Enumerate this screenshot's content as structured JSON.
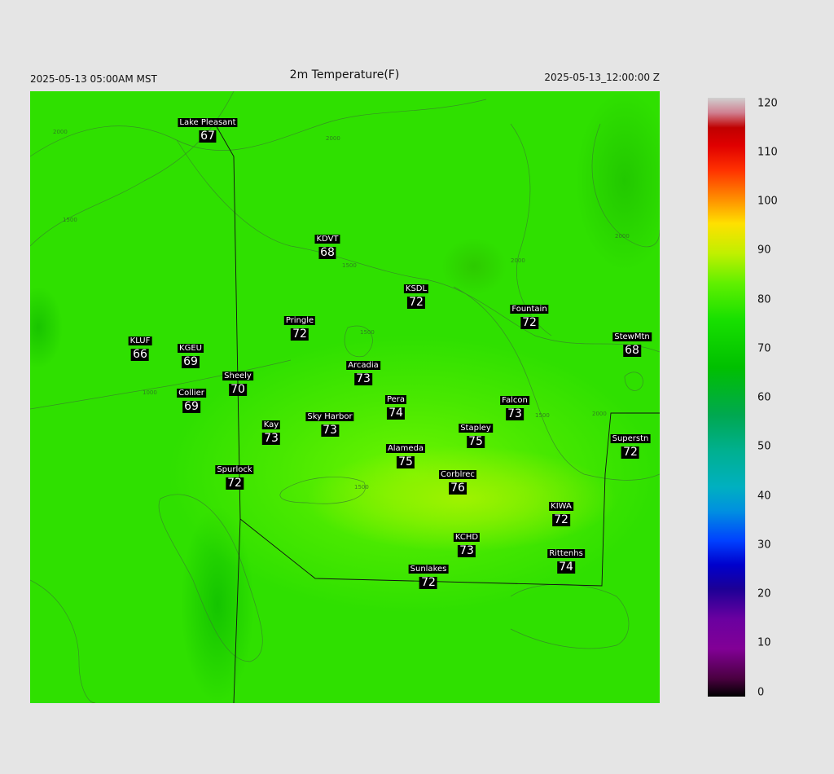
{
  "header": {
    "local_time": "2025-05-13 05:00AM MST",
    "title": "2m Temperature(F)",
    "utc_time": "2025-05-13_12:00:00 Z"
  },
  "contour_labels": [
    "2000",
    "1500",
    "1000",
    "1500",
    "1500",
    "1500",
    "2000",
    "1500",
    "2000",
    "2000",
    "2000"
  ],
  "stations": [
    {
      "name": "Lake Pleasant",
      "value": "67"
    },
    {
      "name": "KDVT",
      "value": "68"
    },
    {
      "name": "KSDL",
      "value": "72"
    },
    {
      "name": "Pringle",
      "value": "72"
    },
    {
      "name": "Fountain",
      "value": "72"
    },
    {
      "name": "KLUF",
      "value": "66"
    },
    {
      "name": "KGEU",
      "value": "69"
    },
    {
      "name": "StewMtn",
      "value": "68"
    },
    {
      "name": "Arcadia",
      "value": "73"
    },
    {
      "name": "Sheely",
      "value": "70"
    },
    {
      "name": "Collier",
      "value": "69"
    },
    {
      "name": "Pera",
      "value": "74"
    },
    {
      "name": "Falcon",
      "value": "73"
    },
    {
      "name": "Sky Harbor",
      "value": "73"
    },
    {
      "name": "Kay",
      "value": "73"
    },
    {
      "name": "Stapley",
      "value": "75"
    },
    {
      "name": "Superstn",
      "value": "72"
    },
    {
      "name": "Alameda",
      "value": "75"
    },
    {
      "name": "Spurlock",
      "value": "72"
    },
    {
      "name": "Corblrec",
      "value": "76"
    },
    {
      "name": "KIWA",
      "value": "72"
    },
    {
      "name": "KCHD",
      "value": "73"
    },
    {
      "name": "Rittenhs",
      "value": "74"
    },
    {
      "name": "Sunlakes",
      "value": "72"
    }
  ],
  "colorbar": {
    "labels": [
      "120",
      "110",
      "100",
      "90",
      "80",
      "70",
      "60",
      "50",
      "40",
      "30",
      "20",
      "10",
      "0"
    ],
    "min": 0,
    "max": 120,
    "colors": [
      "#000000",
      "#820096",
      "#0000cc",
      "#0090e0",
      "#00b090",
      "#00c000",
      "#18e000",
      "#c0f000",
      "#ffe000",
      "#ff9000",
      "#e00000",
      "#d0d0d0"
    ]
  }
}
